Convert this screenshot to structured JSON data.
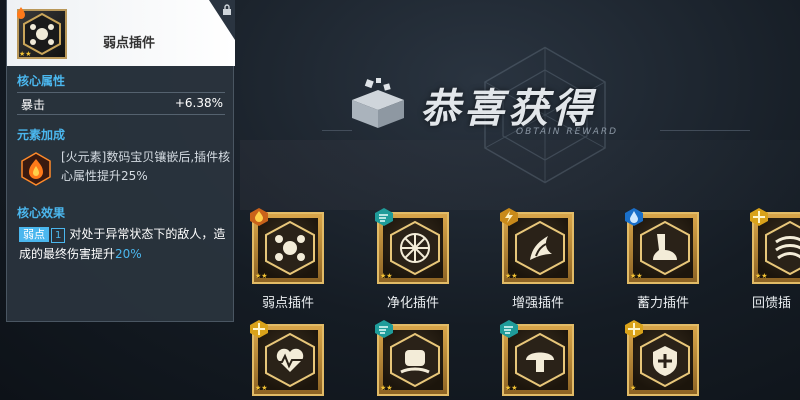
{
  "banner": {
    "title": "恭喜获得",
    "subtitle": "OBTAIN REWARD"
  },
  "panel": {
    "item_name": "弱点插件",
    "stars": "★★",
    "core_attr_title": "核心属性",
    "core_attr_name": "暴击",
    "core_attr_value": "+6.38%",
    "element_bonus_title": "元素加成",
    "element_bonus_text": "[火元素]数码宝贝镶嵌后,插件核心属性提升25%",
    "core_effect_title": "核心效果",
    "effect_tag": "弱点",
    "effect_level": "1",
    "effect_text_before": "对处于异常状态下的敌人，造成的最终伤害提升",
    "effect_highlight": "20%"
  },
  "items": [
    {
      "label": "弱点插件",
      "element": "fire-icon",
      "stars": "★★"
    },
    {
      "label": "净化插件",
      "element": "wind-icon",
      "stars": "★★"
    },
    {
      "label": "增强插件",
      "element": "thunder-icon",
      "stars": "★★"
    },
    {
      "label": "蓄力插件",
      "element": "water-icon",
      "stars": "★★"
    },
    {
      "label": "回馈插",
      "element": "light-icon",
      "stars": "★★"
    },
    {
      "label": "",
      "element": "light-icon",
      "stars": "★★"
    },
    {
      "label": "",
      "element": "wind-icon",
      "stars": "★★"
    },
    {
      "label": "",
      "element": "wind-icon",
      "stars": "★★"
    },
    {
      "label": "",
      "element": "light-icon",
      "stars": "★"
    }
  ]
}
